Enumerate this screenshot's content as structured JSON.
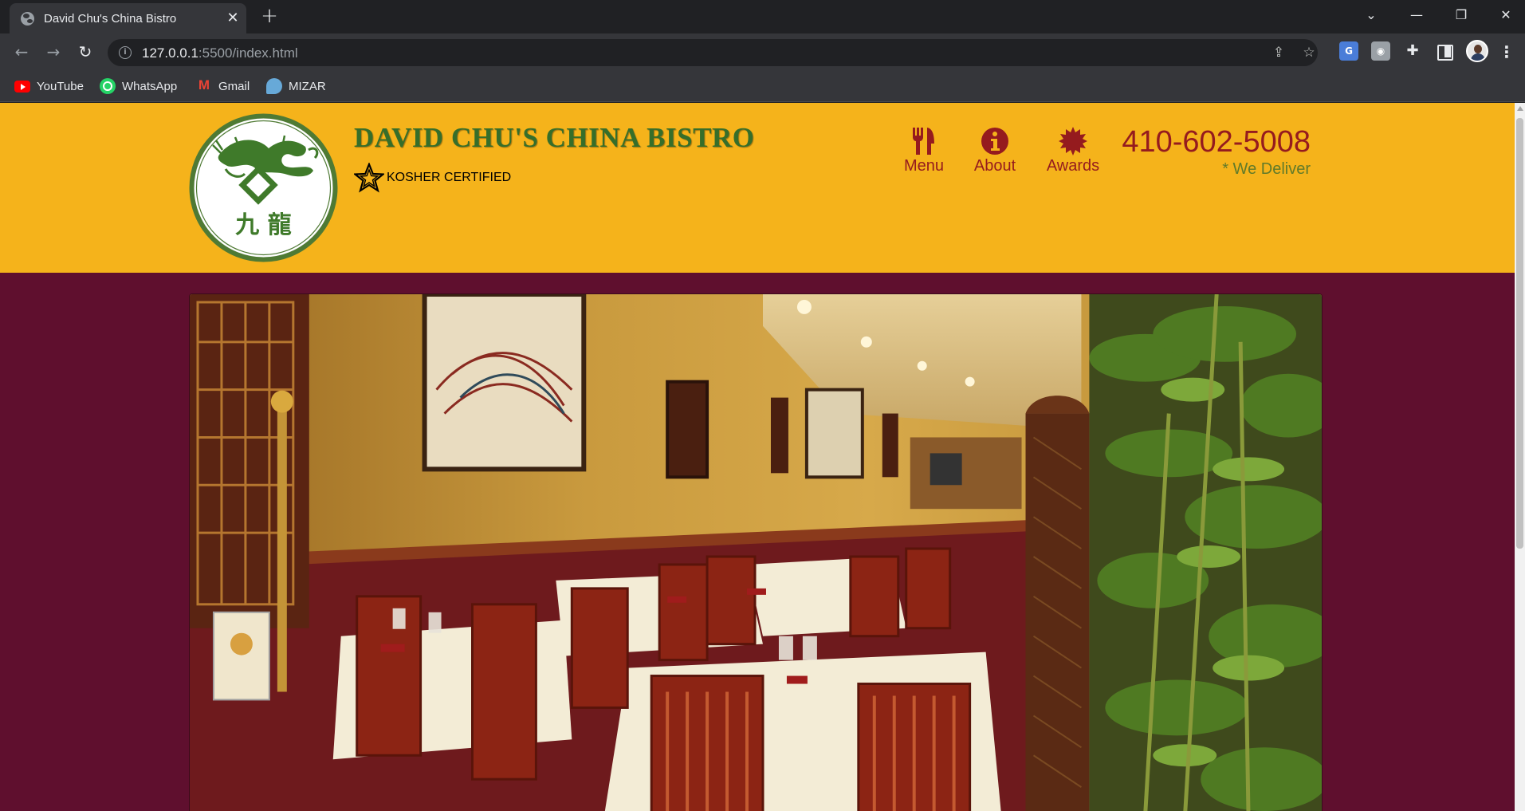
{
  "browser": {
    "tab_title": "David Chu's China Bistro",
    "url_host": "127.0.0.1",
    "url_path": ":5500/index.html",
    "bookmarks": [
      "YouTube",
      "WhatsApp",
      "Gmail",
      "MIZAR"
    ]
  },
  "site": {
    "brand_name": "DAVID CHU'S CHINA BISTRO",
    "kosher_label": "KOSHER CERTIFIED",
    "logo_characters": "九 龍",
    "nav": {
      "menu": "Menu",
      "about": "About",
      "awards": "Awards"
    },
    "phone": "410-602-5008",
    "delivery_note": "* We Deliver"
  },
  "colors": {
    "header_bg": "#f5b31b",
    "page_bg": "#5f0f2e",
    "brand_green": "#366e2a",
    "accent_red": "#951b1e"
  },
  "icons": {
    "menu": "fork-knife-icon",
    "about": "info-icon",
    "awards": "award-badge-icon",
    "kosher": "star-icon"
  }
}
